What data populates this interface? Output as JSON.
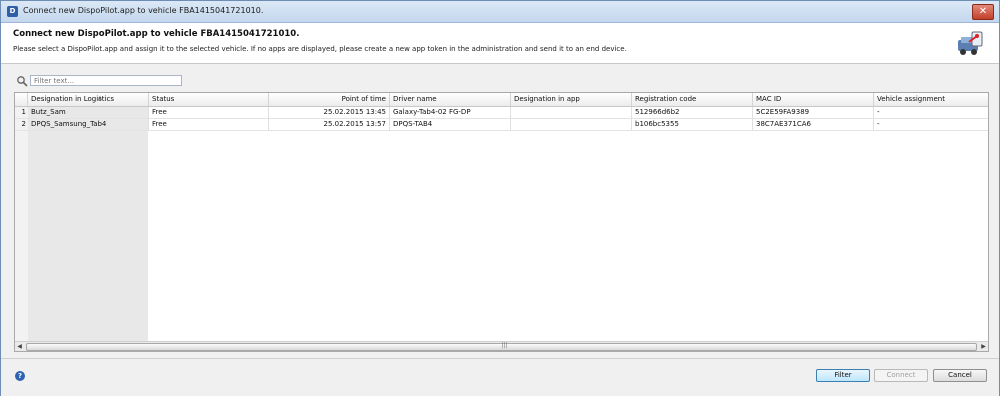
{
  "window": {
    "title": "Connect new DispoPilot.app to vehicle FBA1415041721010.",
    "close_glyph": "✕"
  },
  "header": {
    "title": "Connect new DispoPilot.app to vehicle FBA1415041721010.",
    "description": "Please select a DispoPilot.app and assign it to the selected vehicle. If no apps are displayed, please create a new app token in the administration and send it to an end device."
  },
  "filter": {
    "placeholder": "Filter text..."
  },
  "table": {
    "columns": {
      "designation_logistics": "Designation in Logistics",
      "status": "Status",
      "point_of_time": "Point of time",
      "driver_name": "Driver name",
      "designation_app": "Designation in app",
      "registration_code": "Registration code",
      "mac_id": "MAC ID",
      "vehicle_assignment": "Vehicle assignment"
    },
    "rows": [
      {
        "num": "1",
        "designation_logistics": "Butz_Sam",
        "status": "Free",
        "point_of_time": "25.02.2015 13:45",
        "driver_name": "Galaxy-Tab4-02  FG-DP",
        "designation_app": "",
        "registration_code": "512966d6b2",
        "mac_id": "5C2E59FA9389",
        "vehicle_assignment": "-"
      },
      {
        "num": "2",
        "designation_logistics": "DPQS_Samsung_Tab4",
        "status": "Free",
        "point_of_time": "25.02.2015 13:57",
        "driver_name": "DPQS-TAB4",
        "designation_app": "",
        "registration_code": "b106bc5355",
        "mac_id": "38C7AE371CA6",
        "vehicle_assignment": "-"
      }
    ]
  },
  "buttons": {
    "filter": "Filter",
    "connect": "Connect",
    "cancel": "Cancel"
  },
  "icons": {
    "app": "app-icon",
    "close": "close-icon",
    "header_art": "vehicle-connect-icon",
    "search": "search-icon",
    "help": "help-icon"
  },
  "colors": {
    "primary_button": "#bee6fd",
    "help_icon": "#2d62b0",
    "close_button": "#c1402a"
  }
}
